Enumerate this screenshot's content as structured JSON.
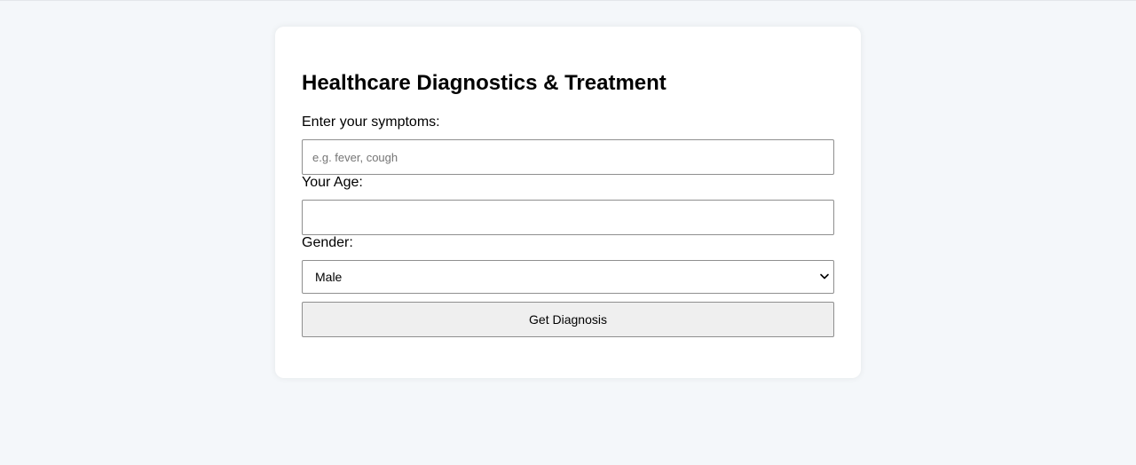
{
  "form": {
    "title": "Healthcare Diagnostics & Treatment",
    "symptoms": {
      "label": "Enter your symptoms:",
      "placeholder": "e.g. fever, cough",
      "value": ""
    },
    "age": {
      "label": "Your Age:",
      "value": ""
    },
    "gender": {
      "label": "Gender:",
      "selected": "Male"
    },
    "submit_label": "Get Diagnosis"
  },
  "colors": {
    "page_background": "#f4f7fa",
    "card_background": "#ffffff",
    "field_border": "#8f8f8f",
    "button_background": "#efefef"
  },
  "icons": {
    "select_arrow": "chevron-down-icon"
  }
}
